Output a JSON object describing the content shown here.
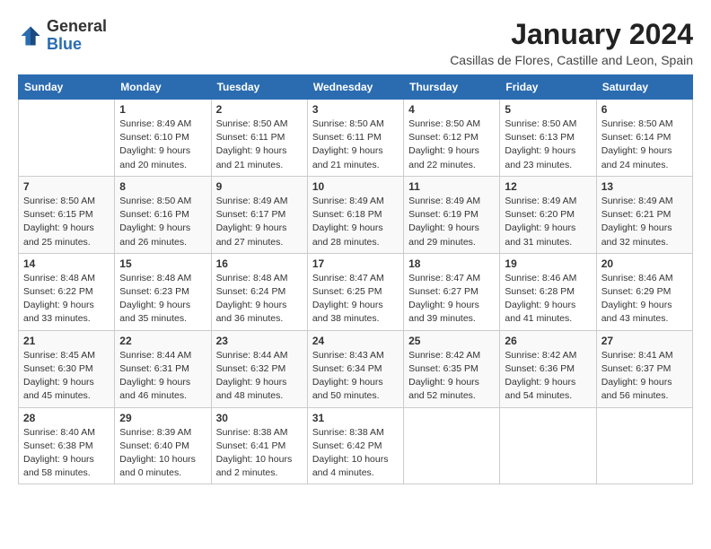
{
  "header": {
    "logo_general": "General",
    "logo_blue": "Blue",
    "month_title": "January 2024",
    "location": "Casillas de Flores, Castille and Leon, Spain"
  },
  "columns": [
    "Sunday",
    "Monday",
    "Tuesday",
    "Wednesday",
    "Thursday",
    "Friday",
    "Saturday"
  ],
  "weeks": [
    [
      {
        "day": "",
        "info": ""
      },
      {
        "day": "1",
        "info": "Sunrise: 8:49 AM\nSunset: 6:10 PM\nDaylight: 9 hours\nand 20 minutes."
      },
      {
        "day": "2",
        "info": "Sunrise: 8:50 AM\nSunset: 6:11 PM\nDaylight: 9 hours\nand 21 minutes."
      },
      {
        "day": "3",
        "info": "Sunrise: 8:50 AM\nSunset: 6:11 PM\nDaylight: 9 hours\nand 21 minutes."
      },
      {
        "day": "4",
        "info": "Sunrise: 8:50 AM\nSunset: 6:12 PM\nDaylight: 9 hours\nand 22 minutes."
      },
      {
        "day": "5",
        "info": "Sunrise: 8:50 AM\nSunset: 6:13 PM\nDaylight: 9 hours\nand 23 minutes."
      },
      {
        "day": "6",
        "info": "Sunrise: 8:50 AM\nSunset: 6:14 PM\nDaylight: 9 hours\nand 24 minutes."
      }
    ],
    [
      {
        "day": "7",
        "info": "Sunrise: 8:50 AM\nSunset: 6:15 PM\nDaylight: 9 hours\nand 25 minutes."
      },
      {
        "day": "8",
        "info": "Sunrise: 8:50 AM\nSunset: 6:16 PM\nDaylight: 9 hours\nand 26 minutes."
      },
      {
        "day": "9",
        "info": "Sunrise: 8:49 AM\nSunset: 6:17 PM\nDaylight: 9 hours\nand 27 minutes."
      },
      {
        "day": "10",
        "info": "Sunrise: 8:49 AM\nSunset: 6:18 PM\nDaylight: 9 hours\nand 28 minutes."
      },
      {
        "day": "11",
        "info": "Sunrise: 8:49 AM\nSunset: 6:19 PM\nDaylight: 9 hours\nand 29 minutes."
      },
      {
        "day": "12",
        "info": "Sunrise: 8:49 AM\nSunset: 6:20 PM\nDaylight: 9 hours\nand 31 minutes."
      },
      {
        "day": "13",
        "info": "Sunrise: 8:49 AM\nSunset: 6:21 PM\nDaylight: 9 hours\nand 32 minutes."
      }
    ],
    [
      {
        "day": "14",
        "info": "Sunrise: 8:48 AM\nSunset: 6:22 PM\nDaylight: 9 hours\nand 33 minutes."
      },
      {
        "day": "15",
        "info": "Sunrise: 8:48 AM\nSunset: 6:23 PM\nDaylight: 9 hours\nand 35 minutes."
      },
      {
        "day": "16",
        "info": "Sunrise: 8:48 AM\nSunset: 6:24 PM\nDaylight: 9 hours\nand 36 minutes."
      },
      {
        "day": "17",
        "info": "Sunrise: 8:47 AM\nSunset: 6:25 PM\nDaylight: 9 hours\nand 38 minutes."
      },
      {
        "day": "18",
        "info": "Sunrise: 8:47 AM\nSunset: 6:27 PM\nDaylight: 9 hours\nand 39 minutes."
      },
      {
        "day": "19",
        "info": "Sunrise: 8:46 AM\nSunset: 6:28 PM\nDaylight: 9 hours\nand 41 minutes."
      },
      {
        "day": "20",
        "info": "Sunrise: 8:46 AM\nSunset: 6:29 PM\nDaylight: 9 hours\nand 43 minutes."
      }
    ],
    [
      {
        "day": "21",
        "info": "Sunrise: 8:45 AM\nSunset: 6:30 PM\nDaylight: 9 hours\nand 45 minutes."
      },
      {
        "day": "22",
        "info": "Sunrise: 8:44 AM\nSunset: 6:31 PM\nDaylight: 9 hours\nand 46 minutes."
      },
      {
        "day": "23",
        "info": "Sunrise: 8:44 AM\nSunset: 6:32 PM\nDaylight: 9 hours\nand 48 minutes."
      },
      {
        "day": "24",
        "info": "Sunrise: 8:43 AM\nSunset: 6:34 PM\nDaylight: 9 hours\nand 50 minutes."
      },
      {
        "day": "25",
        "info": "Sunrise: 8:42 AM\nSunset: 6:35 PM\nDaylight: 9 hours\nand 52 minutes."
      },
      {
        "day": "26",
        "info": "Sunrise: 8:42 AM\nSunset: 6:36 PM\nDaylight: 9 hours\nand 54 minutes."
      },
      {
        "day": "27",
        "info": "Sunrise: 8:41 AM\nSunset: 6:37 PM\nDaylight: 9 hours\nand 56 minutes."
      }
    ],
    [
      {
        "day": "28",
        "info": "Sunrise: 8:40 AM\nSunset: 6:38 PM\nDaylight: 9 hours\nand 58 minutes."
      },
      {
        "day": "29",
        "info": "Sunrise: 8:39 AM\nSunset: 6:40 PM\nDaylight: 10 hours\nand 0 minutes."
      },
      {
        "day": "30",
        "info": "Sunrise: 8:38 AM\nSunset: 6:41 PM\nDaylight: 10 hours\nand 2 minutes."
      },
      {
        "day": "31",
        "info": "Sunrise: 8:38 AM\nSunset: 6:42 PM\nDaylight: 10 hours\nand 4 minutes."
      },
      {
        "day": "",
        "info": ""
      },
      {
        "day": "",
        "info": ""
      },
      {
        "day": "",
        "info": ""
      }
    ]
  ]
}
